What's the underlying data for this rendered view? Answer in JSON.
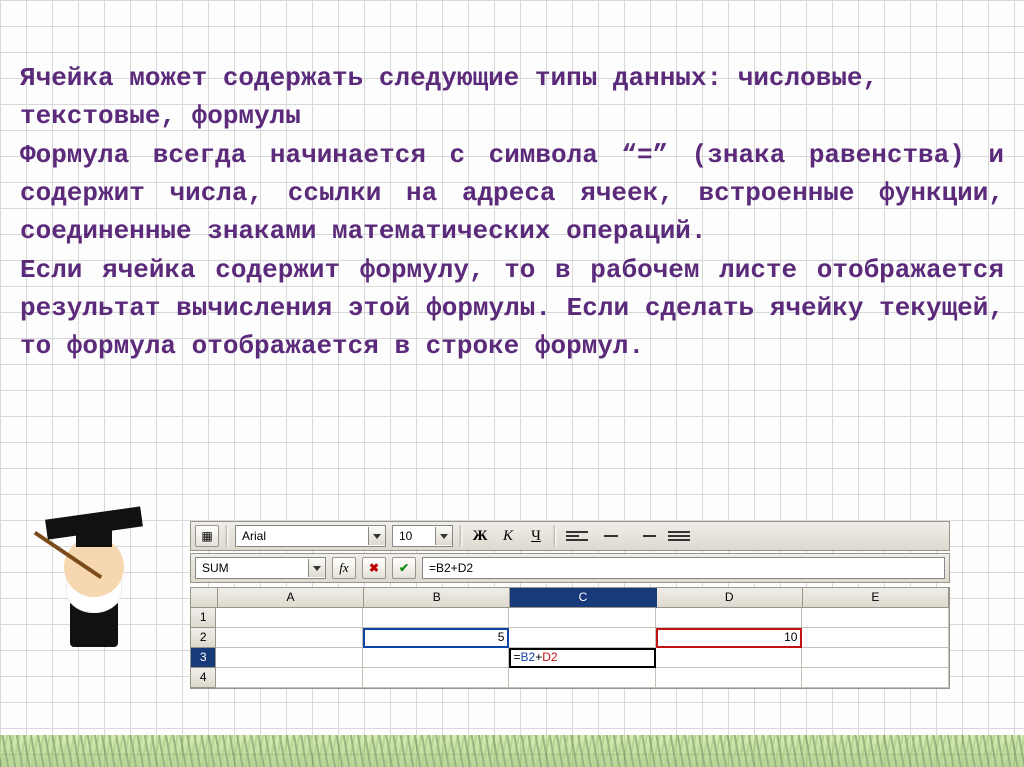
{
  "text": {
    "p1": "Ячейка может содержать следующие типы данных: числовые, текстовые, формулы",
    "p2": "Формула всегда начинается с символа “=” (знака равенства) и содержит числа, ссылки на адреса ячеек, встроенные функции, соединенные знаками математических операций.",
    "p3": "Если ячейка содержит формулу, то в рабочем листе отображается результат вычисления этой формулы. Если сделать ячейку текущей, то формула отображается в строке формул."
  },
  "toolbar": {
    "font_name": "Arial",
    "font_size": "10",
    "bold": "Ж",
    "italic": "К",
    "underline": "Ч"
  },
  "formula_bar": {
    "name_box": "SUM",
    "fx_label": "fx",
    "cancel": "✖",
    "accept": "✔",
    "input": "=B2+D2"
  },
  "grid": {
    "columns": [
      "A",
      "B",
      "C",
      "D",
      "E"
    ],
    "selected_col": "C",
    "rows": [
      "1",
      "2",
      "3",
      "4"
    ],
    "selected_row": "3",
    "cells": {
      "B2": "5",
      "D2": "10",
      "C3_lead": "=",
      "C3_ref1": "B2",
      "C3_plus": "+",
      "C3_ref2": "D2"
    }
  }
}
